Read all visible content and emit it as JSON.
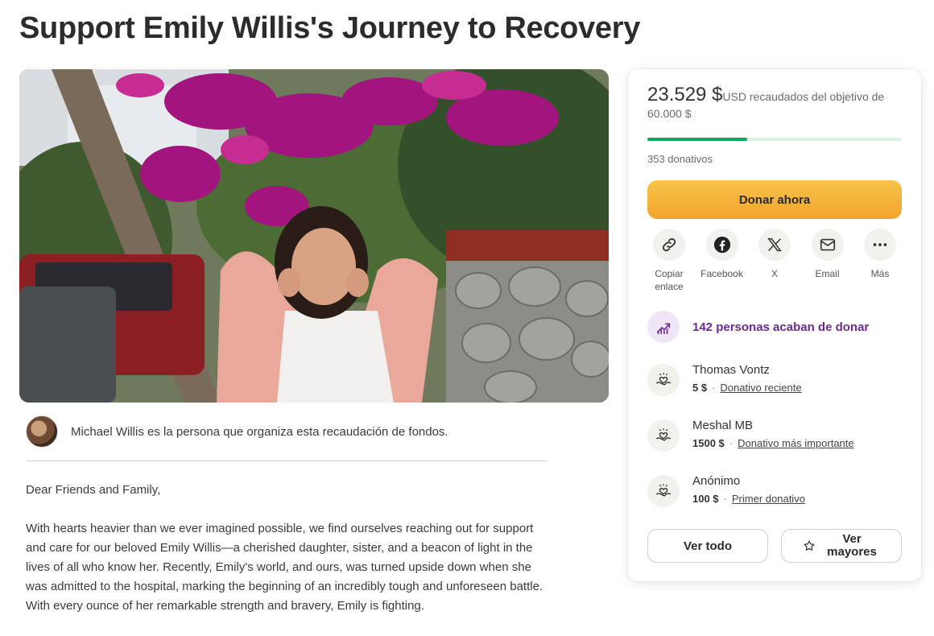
{
  "page": {
    "title": "Support Emily Willis's Journey to Recovery"
  },
  "organizer": {
    "text": "Michael Willis es la persona que organiza esta recaudación de fondos."
  },
  "story": {
    "paragraphs": [
      "Dear Friends and Family,",
      "With hearts heavier than we ever imagined possible, we find ourselves reaching out for support and care for our beloved Emily Willis—a cherished daughter, sister, and a beacon of light in the lives of all who know her. Recently, Emily's world, and ours, was turned upside down when she was admitted to the hospital, marking the beginning of an incredibly tough and unforeseen battle. With every ounce of her remarkable strength and bravery, Emily is fighting."
    ]
  },
  "card": {
    "raised_amount": "23.529 $",
    "raised_rest": "USD recaudados del objetivo de 60.000 $",
    "progress_fraction": 0.392,
    "donation_count": "353 donativos",
    "donate_label": "Donar ahora",
    "share": [
      {
        "label": "Copiar enlace",
        "icon": "link-icon"
      },
      {
        "label": "Facebook",
        "icon": "facebook-icon"
      },
      {
        "label": "X",
        "icon": "x-icon"
      },
      {
        "label": "Email",
        "icon": "email-icon"
      },
      {
        "label": "Más",
        "icon": "more-icon"
      }
    ],
    "recent_text": "142 personas acaban de donar",
    "donors": [
      {
        "name": "Thomas Vontz",
        "amount": "5 $",
        "tag": "Donativo reciente"
      },
      {
        "name": "Meshal MB",
        "amount": "1500 $",
        "tag": "Donativo más importante"
      },
      {
        "name": "Anónimo",
        "amount": "100 $",
        "tag": "Primer donativo"
      }
    ],
    "see_all_label": "Ver todo",
    "see_top_label": "Ver mayores"
  },
  "colors": {
    "accent_green": "#02a95c",
    "donate_orange": "#f2a42d",
    "recent_purple": "#6b2b8f"
  }
}
